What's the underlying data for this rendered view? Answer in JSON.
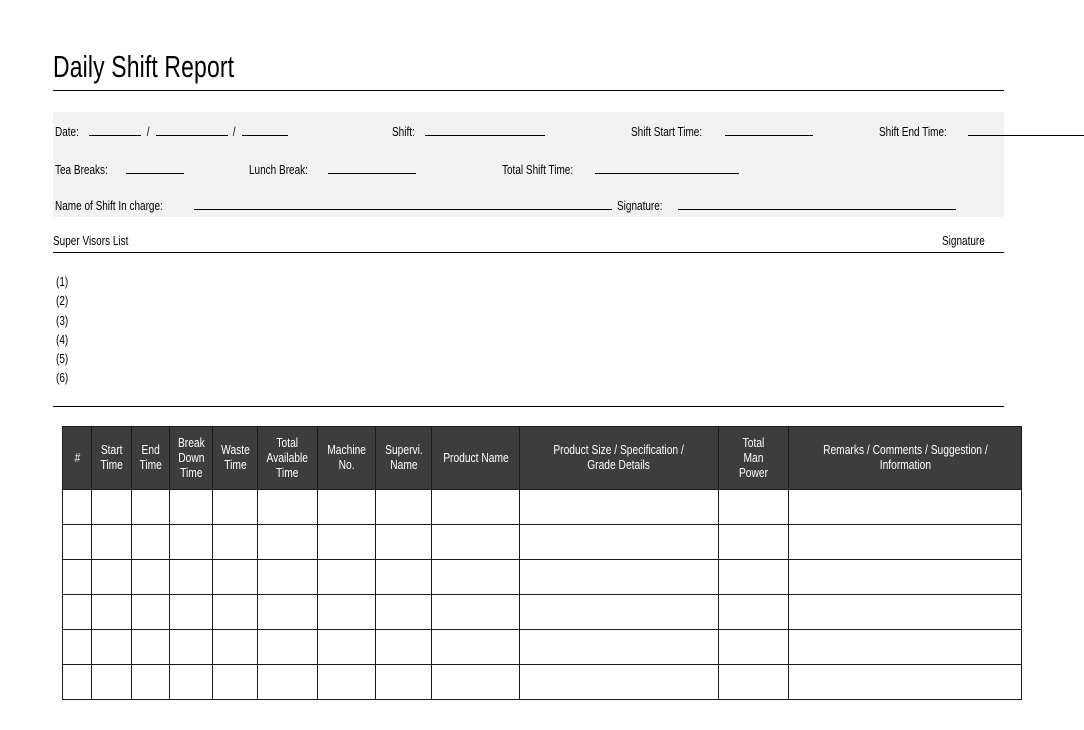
{
  "document": {
    "title": "Daily Shift Report"
  },
  "header_fields": {
    "date_label": "Date:",
    "date_separator": "/",
    "shift_label": "Shift:",
    "shift_start_label": "Shift Start Time:",
    "shift_end_label": "Shift End Time:",
    "tea_breaks_label": "Tea Breaks:",
    "lunch_break_label": "Lunch Break:",
    "total_shift_time_label": "Total Shift Time:",
    "name_in_charge_label": "Name of Shift In charge:",
    "signature_label": "Signature:"
  },
  "supervisors": {
    "list_label": "Super Visors List",
    "signature_label": "Signature",
    "items": [
      "(1)",
      "(2)",
      "(3)",
      "(4)",
      "(5)",
      "(6)"
    ]
  },
  "table": {
    "columns": [
      "#",
      "Start\nTime",
      "End\nTime",
      "Break\nDown\nTime",
      "Waste\nTime",
      "Total\nAvailable\nTime",
      "Machine\nNo.",
      "Supervi.\nName",
      "Product Name",
      "Product Size / Specification /\nGrade Details",
      "Total\nMan Power",
      "Remarks / Comments / Suggestion /\nInformation"
    ],
    "rows": [
      [
        "",
        "",
        "",
        "",
        "",
        "",
        "",
        "",
        "",
        "",
        "",
        ""
      ],
      [
        "",
        "",
        "",
        "",
        "",
        "",
        "",
        "",
        "",
        "",
        "",
        ""
      ],
      [
        "",
        "",
        "",
        "",
        "",
        "",
        "",
        "",
        "",
        "",
        "",
        ""
      ],
      [
        "",
        "",
        "",
        "",
        "",
        "",
        "",
        "",
        "",
        "",
        "",
        ""
      ],
      [
        "",
        "",
        "",
        "",
        "",
        "",
        "",
        "",
        "",
        "",
        "",
        ""
      ],
      [
        "",
        "",
        "",
        "",
        "",
        "",
        "",
        "",
        "",
        "",
        "",
        ""
      ]
    ]
  },
  "colors": {
    "header_background": "#3d3d3d",
    "header_text": "#ffffff",
    "panel_background": "#f2f2f2",
    "rule": "#000000",
    "page_background": "#ffffff"
  }
}
